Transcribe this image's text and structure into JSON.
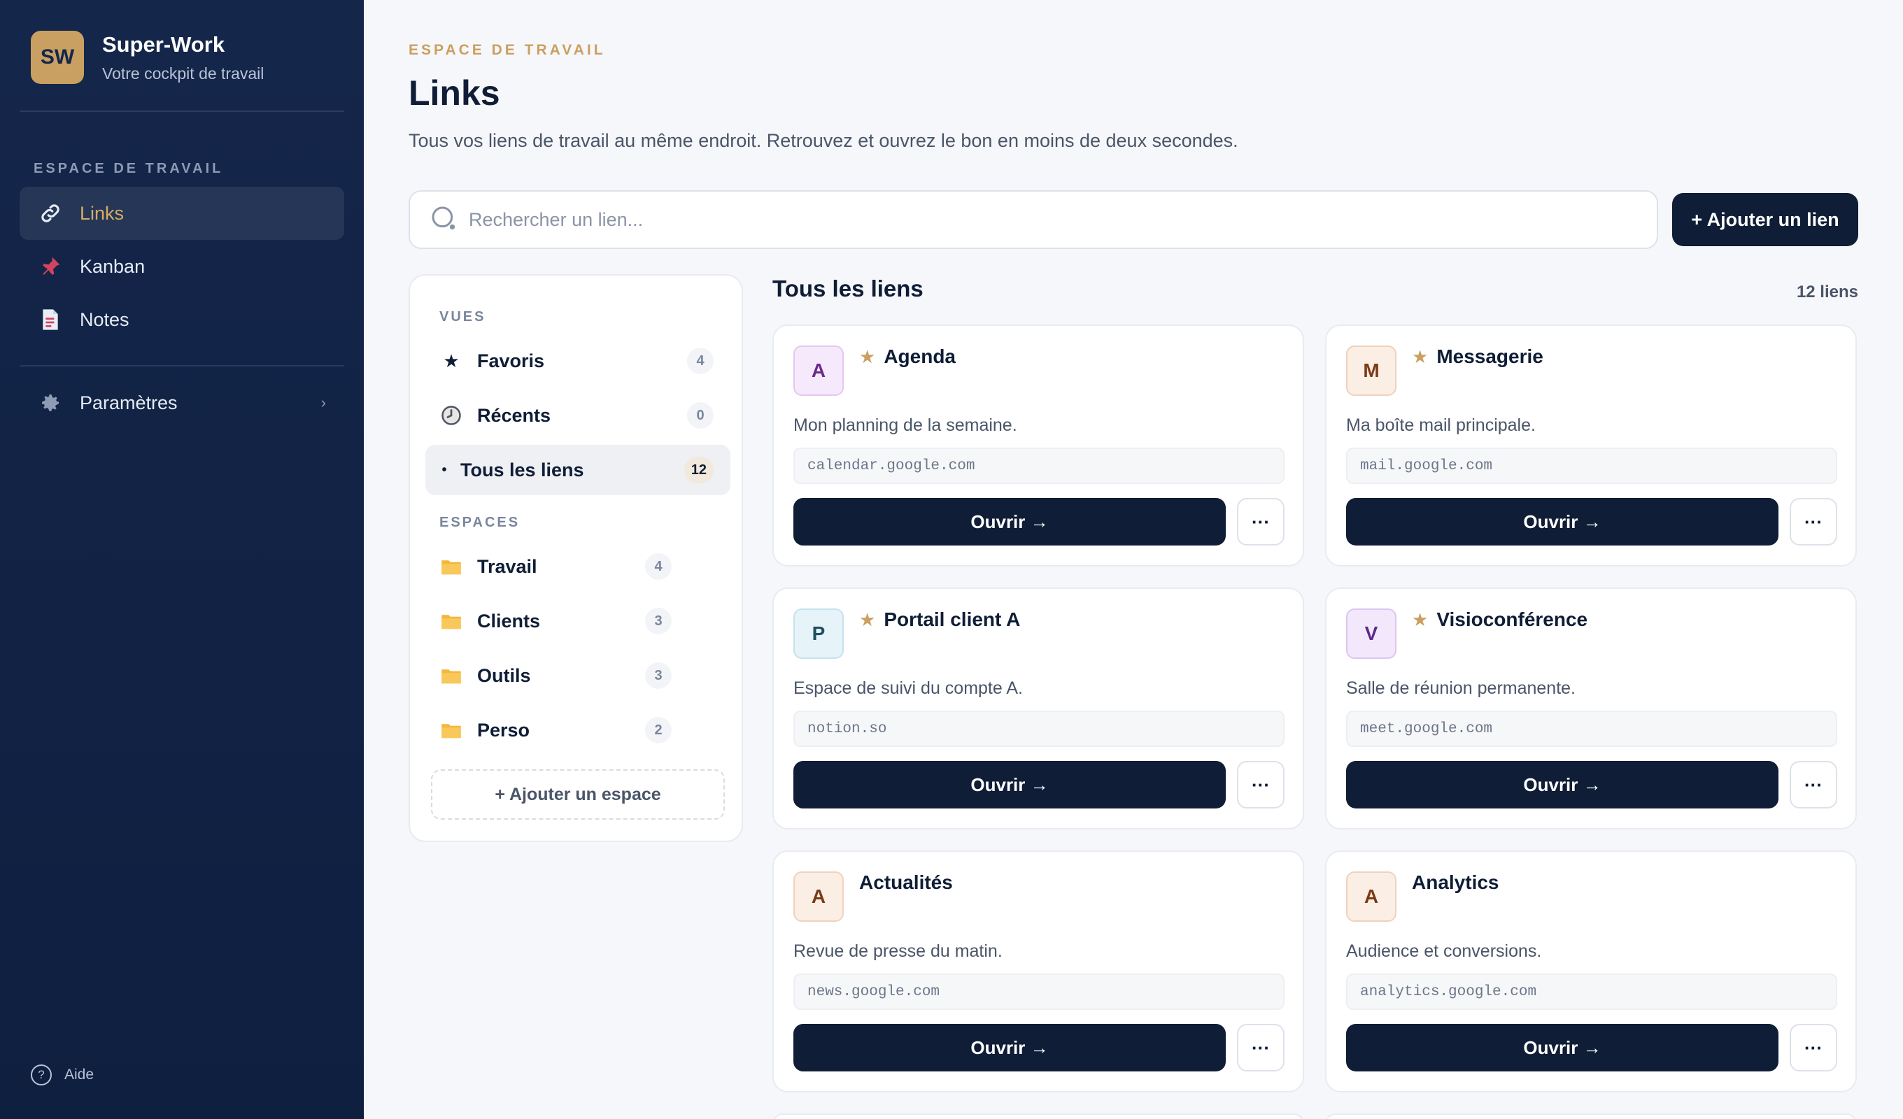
{
  "brand": {
    "logo": "SW",
    "name": "Super-Work",
    "subtitle": "Votre cockpit de travail"
  },
  "sidebar": {
    "section": "ESPACE DE TRAVAIL",
    "items": [
      {
        "label": "Links",
        "icon": "link-icon",
        "active": true
      },
      {
        "label": "Kanban",
        "icon": "pin-icon"
      },
      {
        "label": "Notes",
        "icon": "note-icon"
      }
    ],
    "settings": {
      "label": "Paramètres",
      "icon": "gear-icon"
    },
    "help": "Aide"
  },
  "header": {
    "eyebrow": "ESPACE DE TRAVAIL",
    "title": "Links",
    "description": "Tous vos liens de travail au même endroit. Retrouvez et ouvrez le bon en moins de deux secondes."
  },
  "search": {
    "placeholder": "Rechercher un lien...",
    "value": ""
  },
  "add_link_label": "+ Ajouter un lien",
  "filters": {
    "views_title": "VUES",
    "views": [
      {
        "label": "Favoris",
        "count": "4",
        "icon": "star-icon"
      },
      {
        "label": "Récents",
        "count": "0",
        "icon": "clock-icon"
      },
      {
        "label": "Tous les liens",
        "count": "12",
        "icon": "dot-icon",
        "active": true
      }
    ],
    "spaces_title": "ESPACES",
    "spaces": [
      {
        "label": "Travail",
        "count": "4"
      },
      {
        "label": "Clients",
        "count": "3"
      },
      {
        "label": "Outils",
        "count": "3"
      },
      {
        "label": "Perso",
        "count": "2"
      }
    ],
    "add_space_label": "+ Ajouter un espace"
  },
  "list": {
    "title": "Tous les liens",
    "count": "12 liens",
    "open_label": "Ouvrir →",
    "more_label": "···",
    "cards": [
      {
        "letter": "A",
        "title": "Agenda",
        "favorite": true,
        "description": "Mon planning de la semaine.",
        "url": "calendar.google.com",
        "color": "#6b2a8a",
        "bg": "#f6e9fb",
        "border": "#e3c8f0"
      },
      {
        "letter": "M",
        "title": "Messagerie",
        "favorite": true,
        "description": "Ma boîte mail principale.",
        "url": "mail.google.com",
        "color": "#7a3a18",
        "bg": "#fbeee4",
        "border": "#f0d2bd"
      },
      {
        "letter": "P",
        "title": "Portail client A",
        "favorite": true,
        "description": "Espace de suivi du compte A.",
        "url": "notion.so",
        "color": "#1f4f5e",
        "bg": "#e6f3f8",
        "border": "#c6e2ec"
      },
      {
        "letter": "V",
        "title": "Visioconférence",
        "favorite": true,
        "description": "Salle de réunion permanente.",
        "url": "meet.google.com",
        "color": "#5a2a8a",
        "bg": "#f3e8fb",
        "border": "#dcc6ef"
      },
      {
        "letter": "A",
        "title": "Actualités",
        "favorite": false,
        "description": "Revue de presse du matin.",
        "url": "news.google.com",
        "color": "#7a3a18",
        "bg": "#fbeee4",
        "border": "#f0d2bd"
      },
      {
        "letter": "A",
        "title": "Analytics",
        "favorite": false,
        "description": "Audience et conversions.",
        "url": "analytics.google.com",
        "color": "#7a3a18",
        "bg": "#fbeee4",
        "border": "#f0d2bd"
      }
    ]
  },
  "colors": {
    "navy": "#0f1d36",
    "gold": "#c9a061",
    "sidebar": "#14264a"
  }
}
